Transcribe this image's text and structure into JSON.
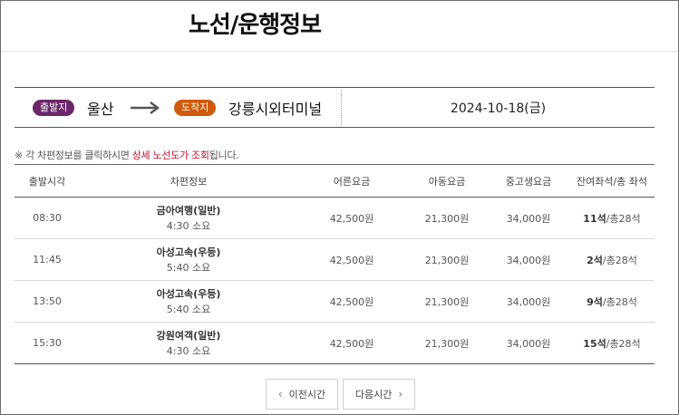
{
  "page": {
    "title": "노선/운행정보"
  },
  "route": {
    "departure_badge": "출발지",
    "departure_city": "울산",
    "arrival_badge": "도착지",
    "arrival_city": "강릉시외터미널",
    "date": "2024-10-18(금)",
    "icons": {
      "arrow": "arrow-right-icon"
    },
    "colors": {
      "departure_badge": "#6b2769",
      "arrival_badge": "#cf5a0b"
    }
  },
  "notice": {
    "prefix": "※ 각 차편정보를 클릭하시면 ",
    "highlight": "상세 노선도가 조회",
    "suffix": "됩니다.",
    "highlight_color": "#c8102e"
  },
  "table": {
    "headers": {
      "time": "출발시각",
      "info": "차편정보",
      "adult": "어른요금",
      "child": "아동요금",
      "student": "중고생요금",
      "seats": "잔여좌석/총 좌석"
    },
    "rows": [
      {
        "time": "08:30",
        "bus_class": "금아여행(일반)",
        "duration": "4:30 소요",
        "adult": "42,500원",
        "child": "21,300원",
        "student": "34,000원",
        "remaining": "11석",
        "total": "/총28석"
      },
      {
        "time": "11:45",
        "bus_class": "아성고속(우등)",
        "duration": "5:40 소요",
        "adult": "42,500원",
        "child": "21,300원",
        "student": "34,000원",
        "remaining": "2석",
        "total": "/총28석"
      },
      {
        "time": "13:50",
        "bus_class": "아성고속(우등)",
        "duration": "5:40 소요",
        "adult": "42,500원",
        "child": "21,300원",
        "student": "34,000원",
        "remaining": "9석",
        "total": "/총28석"
      },
      {
        "time": "15:30",
        "bus_class": "강원여객(일반)",
        "duration": "4:30 소요",
        "adult": "42,500원",
        "child": "21,300원",
        "student": "34,000원",
        "remaining": "15석",
        "total": "/총28석"
      }
    ]
  },
  "pagination": {
    "prev_label": "이전시간",
    "next_label": "다음시간",
    "icons": {
      "prev": "chevron-left-icon",
      "next": "chevron-right-icon"
    }
  }
}
